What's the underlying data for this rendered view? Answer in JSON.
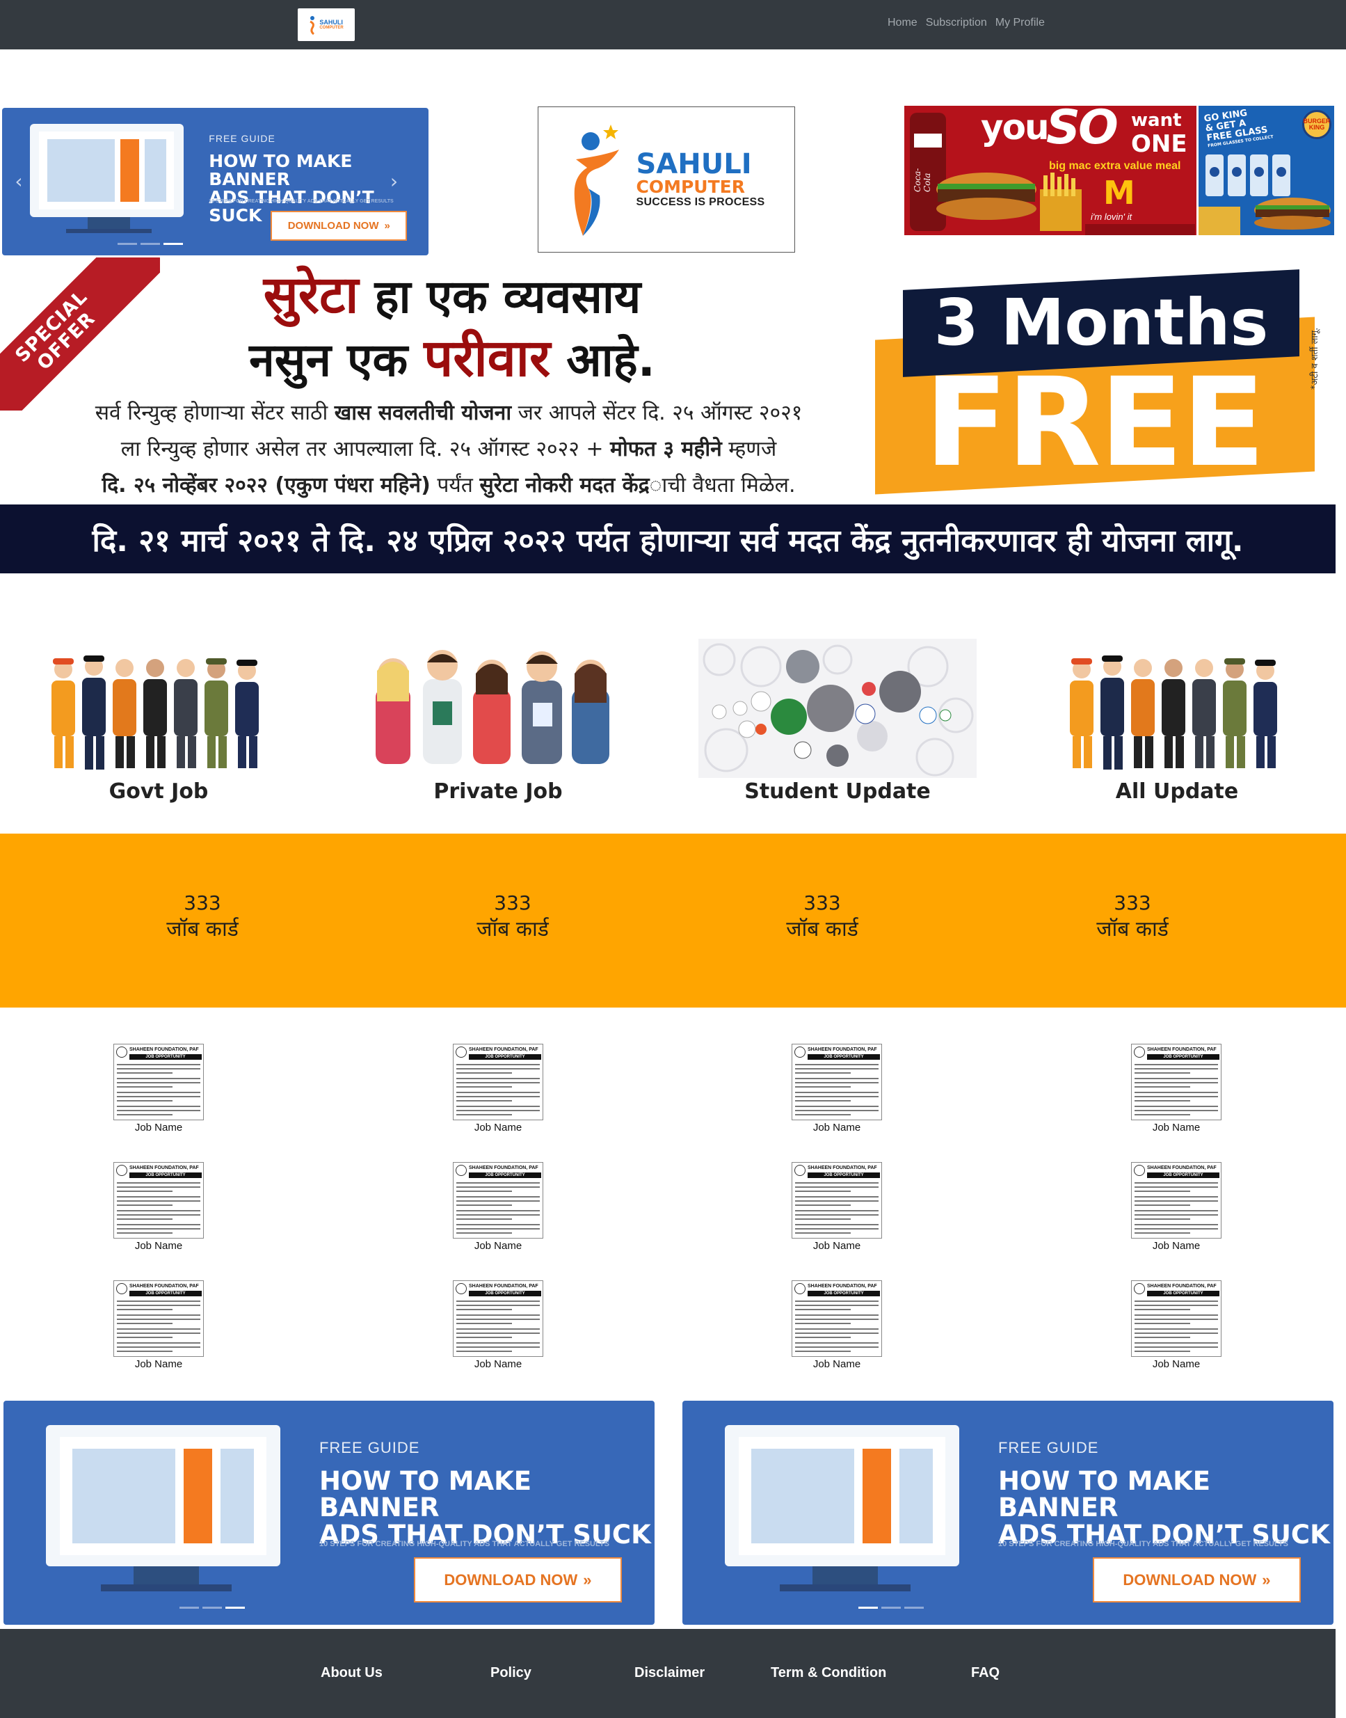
{
  "nav": {
    "logo": {
      "line1": "SAHULI",
      "line2": "COMPUTER"
    },
    "links": [
      "Home",
      "Subscription",
      "My Profile"
    ]
  },
  "top_banner": {
    "label": "FREE GUIDE",
    "title_line1": "HOW TO MAKE BANNER",
    "title_line2": "ADS THAT DON’T SUCK",
    "subtitle": "10 STEPS FOR CREATING HIGH-QUALITY ADS THAT ACTUALLY GET RESULTS",
    "button": "DOWNLOAD NOW",
    "button_arrow": "»",
    "arrow_left": "‹",
    "arrow_right": "›"
  },
  "logo_box": {
    "line1": "SAHULI",
    "line2": "COMPUTER",
    "line3": "SUCCESS IS PROCESS"
  },
  "food_ad": {
    "you": "you",
    "so": "SO",
    "want": "want",
    "one": "ONE",
    "sub": "big mac extra value meal",
    "tag": "i'm lovin' it",
    "brand": "Coca-Cola",
    "arches": "M"
  },
  "king_ad": {
    "text1": "GO KING",
    "text2": "& GET A",
    "text3": "FREE GLASS",
    "text4": "FROM GLASSES TO COLLECT",
    "logo": "BURGER KING"
  },
  "offer": {
    "ribbon1": "SPECIAL",
    "ribbon2": "OFFER",
    "headline_red1": "सुरेटा",
    "headline_rest1": " हा एक व्यवसाय",
    "headline_pre2": "नसुन एक ",
    "headline_red2": "परीवार",
    "headline_post2": " आहे.",
    "para_l1_a": "सर्व रिन्युव्ह होणाऱ्या सेंटर साठी ",
    "para_l1_b": "खास सवलतीची योजना",
    "para_l1_c": " जर आपले सेंटर दि. २५ ऑगस्ट २०२१",
    "para_l2_a": "ला रिन्युव्ह होणार असेल तर आपल्याला दि. २५ ऑगस्ट २०२२ + ",
    "para_l2_b": "मोफत ३ महीने",
    "para_l2_c": " म्हणजे",
    "para_l3_a": "दि. २५ नोव्हेंबर २०२२ (एकुण पंधरा महिने)",
    "para_l3_b": " पर्यंत ",
    "para_l3_c": "सुरेटा नोकरी मदत केंद्र",
    "para_l3_d": "ाची वैधता मिळेल.",
    "months": "3 Months",
    "free": "FREE",
    "note": "*अटी व शर्ती लागू.",
    "date_bar": "दि. २१ मार्च २०२१ ते दि. २४ एप्रिल २०२२ पर्यत होणाऱ्या सर्व मदत केंद्र नुतनीकरणावर ही योजना लागू."
  },
  "categories": [
    {
      "label": "Govt Job"
    },
    {
      "label": "Private Job"
    },
    {
      "label": "Student Update"
    },
    {
      "label": "All Update"
    }
  ],
  "stats": [
    {
      "value": "333",
      "label": "जॉब कार्ड"
    },
    {
      "value": "333",
      "label": "जॉब कार्ड"
    },
    {
      "value": "333",
      "label": "जॉब कार्ड"
    },
    {
      "value": "333",
      "label": "जॉब कार्ड"
    }
  ],
  "job_card": {
    "header": "SHAHEEN FOUNDATION, PAF",
    "bar": "JOB OPPORTUNITY",
    "name": "Job Name"
  },
  "bottom_banners": [
    {
      "label": "FREE GUIDE",
      "title_line1": "HOW TO MAKE BANNER",
      "title_line2": "ADS THAT DON’T SUCK",
      "subtitle": "10 STEPS FOR CREATING HIGH-QUALITY ADS THAT ACTUALLY GET RESULTS",
      "button": "DOWNLOAD NOW",
      "button_arrow": "»"
    },
    {
      "label": "FREE GUIDE",
      "title_line1": "HOW TO MAKE BANNER",
      "title_line2": "ADS THAT DON’T SUCK",
      "subtitle": "10 STEPS FOR CREATING HIGH-QUALITY ADS THAT ACTUALLY GET RESULTS",
      "button": "DOWNLOAD NOW",
      "button_arrow": "»"
    }
  ],
  "footer": {
    "links": [
      "About Us",
      "Policy",
      "Disclaimer",
      "Term & Condition",
      "FAQ"
    ]
  },
  "colors": {
    "nav_bg": "#343a40",
    "stats_bg": "#ffa500",
    "banner_bg": "#3768b8",
    "date_bar_bg": "#0c1130",
    "accent_red": "#9b0d0d"
  }
}
